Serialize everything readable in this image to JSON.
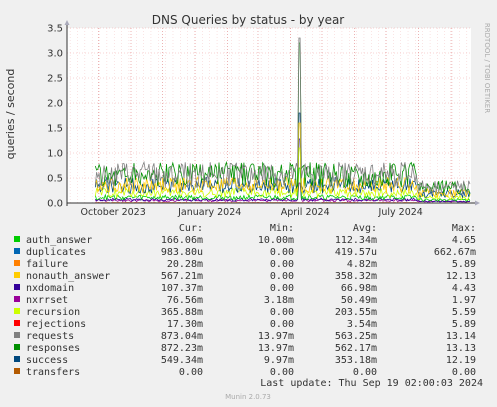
{
  "chart_data": {
    "type": "line",
    "title": "DNS Queries by status - by year",
    "ylabel": "queries / second",
    "xlabel": "",
    "ylim": [
      0,
      3.5
    ],
    "yticks": [
      "0.0",
      "0.5",
      "1.0",
      "1.5",
      "2.0",
      "2.5",
      "3.0",
      "3.5"
    ],
    "xlim": [
      "2023-09-01",
      "2024-09-20"
    ],
    "data_start": "2023-09-28",
    "xticks": [
      {
        "label": "October 2023",
        "date": "2023-10-15"
      },
      {
        "label": "January 2024",
        "date": "2024-01-15"
      },
      {
        "label": "April 2024",
        "date": "2024-04-15"
      },
      {
        "label": "July 2024",
        "date": "2024-07-15"
      }
    ],
    "grid": true,
    "legend_position": "bottom",
    "watermark": "RRDTOOL / TOBI OETIKER",
    "columns": [
      "Cur:",
      "Min:",
      "Avg:",
      "Max:"
    ],
    "series": [
      {
        "name": "auth_answer",
        "color": "#00cc00",
        "cur": "166.06m",
        "min": "10.00m",
        "avg": "112.34m",
        "max": "4.65"
      },
      {
        "name": "duplicates",
        "color": "#0066b3",
        "cur": "983.80u",
        "min": "0.00",
        "avg": "419.57u",
        "max": "662.67m"
      },
      {
        "name": "failure",
        "color": "#ff8000",
        "cur": "20.28m",
        "min": "0.00",
        "avg": "4.82m",
        "max": "5.89"
      },
      {
        "name": "nonauth_answer",
        "color": "#ffcc00",
        "cur": "567.21m",
        "min": "0.00",
        "avg": "358.32m",
        "max": "12.13"
      },
      {
        "name": "nxdomain",
        "color": "#330099",
        "cur": "107.37m",
        "min": "0.00",
        "avg": "66.98m",
        "max": "4.43"
      },
      {
        "name": "nxrrset",
        "color": "#990099",
        "cur": "76.56m",
        "min": "3.18m",
        "avg": "50.49m",
        "max": "1.97"
      },
      {
        "name": "recursion",
        "color": "#ccff00",
        "cur": "365.88m",
        "min": "0.00",
        "avg": "203.55m",
        "max": "5.59"
      },
      {
        "name": "rejections",
        "color": "#ff0000",
        "cur": "17.30m",
        "min": "0.00",
        "avg": "3.54m",
        "max": "5.89"
      },
      {
        "name": "requests",
        "color": "#808080",
        "cur": "873.04m",
        "min": "13.97m",
        "avg": "563.25m",
        "max": "13.14"
      },
      {
        "name": "responses",
        "color": "#008f00",
        "cur": "872.23m",
        "min": "13.97m",
        "avg": "562.17m",
        "max": "13.13"
      },
      {
        "name": "success",
        "color": "#00487d",
        "cur": "549.34m",
        "min": "9.97m",
        "avg": "353.18m",
        "max": "12.19"
      },
      {
        "name": "transfers",
        "color": "#b35a00",
        "cur": "0.00",
        "min": "0.00",
        "avg": "0.00",
        "max": "0.00"
      }
    ],
    "last_update": "Last update: Thu Sep 19 02:00:03 2024",
    "footer": "Munin 2.0.73"
  }
}
